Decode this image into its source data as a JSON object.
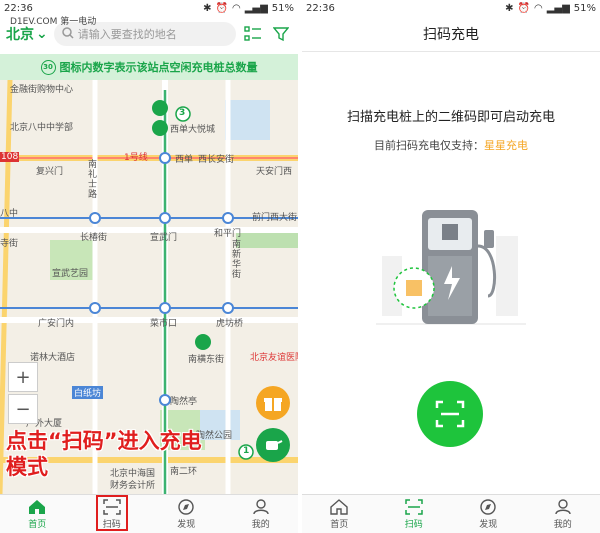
{
  "left": {
    "status": {
      "time": "22:36",
      "battery": "51%"
    },
    "watermark": "D1EV.COM 第一电动",
    "city": "北京",
    "search_placeholder": "请输入要查找的地名",
    "banner": "图标内数字表示该站点空闲充电桩总数量",
    "banner_badge": "30",
    "map_labels": [
      {
        "id": "jinrong",
        "text": "金融街购物中心"
      },
      {
        "id": "xidan_mall",
        "text": "西单大悦城"
      },
      {
        "id": "bayi",
        "text": "北京八中中学部"
      },
      {
        "id": "xidan",
        "text": "西单"
      },
      {
        "id": "xichangan",
        "text": "西长安街"
      },
      {
        "id": "fuxingmen",
        "text": "复兴门"
      },
      {
        "id": "tiananmen",
        "text": "天安门西"
      },
      {
        "id": "nanlishilu",
        "text": "南礼士路"
      },
      {
        "id": "bayi2",
        "text": "八中"
      },
      {
        "id": "sitiao",
        "text": "寺街"
      },
      {
        "id": "changchunjie",
        "text": "长椿街"
      },
      {
        "id": "xuanwumen",
        "text": "宣武门"
      },
      {
        "id": "hepingmen",
        "text": "和平门"
      },
      {
        "id": "qianmen",
        "text": "前门西大街"
      },
      {
        "id": "xuanwu_park",
        "text": "宣武艺园"
      },
      {
        "id": "nanxinhua",
        "text": "南新华街"
      },
      {
        "id": "guanganmen",
        "text": "广安门内"
      },
      {
        "id": "caishikou",
        "text": "菜市口"
      },
      {
        "id": "hufangqiao",
        "text": "虎坊桥"
      },
      {
        "id": "nuojin",
        "text": "诺林大酒店"
      },
      {
        "id": "nanhengdong",
        "text": "南横东街"
      },
      {
        "id": "beijingyouyi",
        "text": "北京友谊医院"
      },
      {
        "id": "baizhifang",
        "text": "白纸坊"
      },
      {
        "id": "taoranting",
        "text": "陶然亭"
      },
      {
        "id": "guangwai",
        "text": "广外大厦"
      },
      {
        "id": "taoran_park",
        "text": "陶然公园"
      },
      {
        "id": "nanerhuan",
        "text": "南二环"
      },
      {
        "id": "zhonghaiguo",
        "text": "北京中海国"
      },
      {
        "id": "finance",
        "text": "财务会计所"
      },
      {
        "id": "num108",
        "text": "108"
      },
      {
        "id": "line1",
        "text": "1号线"
      }
    ],
    "pin_numbers": [
      "3",
      "1"
    ],
    "annotation": "点击“扫码”进入充电模式",
    "zoom_in": "+",
    "zoom_out": "−",
    "tabs": [
      {
        "label": "首页",
        "icon": "home-icon",
        "active": true
      },
      {
        "label": "扫码",
        "icon": "scan-icon",
        "active": false
      },
      {
        "label": "发现",
        "icon": "compass-icon",
        "active": false
      },
      {
        "label": "我的",
        "icon": "user-icon",
        "active": false
      }
    ]
  },
  "right": {
    "status": {
      "time": "22:36",
      "battery": "51%"
    },
    "title": "扫码充电",
    "headline": "扫描充电桩上的二维码即可启动充电",
    "support_prefix": "目前扫码充电仅支持：",
    "support_brand": "星星充电",
    "tabs": [
      {
        "label": "首页",
        "icon": "home-icon",
        "active": false
      },
      {
        "label": "扫码",
        "icon": "scan-icon",
        "active": true
      },
      {
        "label": "发现",
        "icon": "compass-icon",
        "active": false
      },
      {
        "label": "我的",
        "icon": "user-icon",
        "active": false
      }
    ]
  },
  "colors": {
    "brand_green": "#1aa54a",
    "accent_orange": "#f5a623",
    "annotation_red": "#e01e1e"
  }
}
